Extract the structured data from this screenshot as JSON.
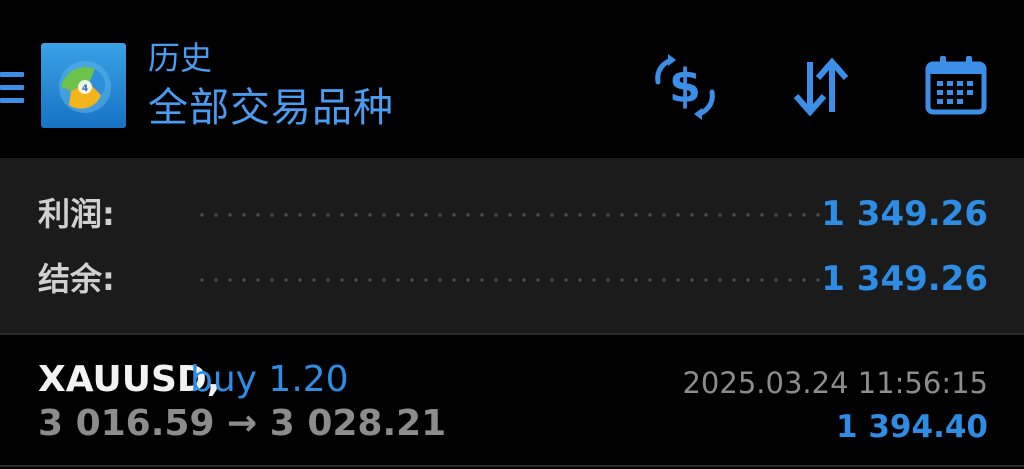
{
  "header": {
    "subtitle": "历史",
    "title": "全部交易品种",
    "icons": {
      "menu": "menu-icon",
      "logo": "metatrader-logo",
      "dollar": "dollar-exchange-icon",
      "sort": "sort-arrows-icon",
      "calendar": "calendar-icon"
    }
  },
  "summary": {
    "profit_label": "利润:",
    "profit_value": "1 349.26",
    "balance_label": "结余:",
    "balance_value": "1 349.26"
  },
  "deals": [
    {
      "symbol": "XAUUSD,",
      "type": "buy 1.20",
      "prices": "3 016.59 → 3 028.21",
      "time": "2025.03.24 11:56:15",
      "profit": "1 394.40"
    }
  ],
  "colors": {
    "accent": "#2d8de4",
    "background": "#000000",
    "summary_background": "#1b1b1b",
    "muted_text": "#8c8c8c"
  }
}
